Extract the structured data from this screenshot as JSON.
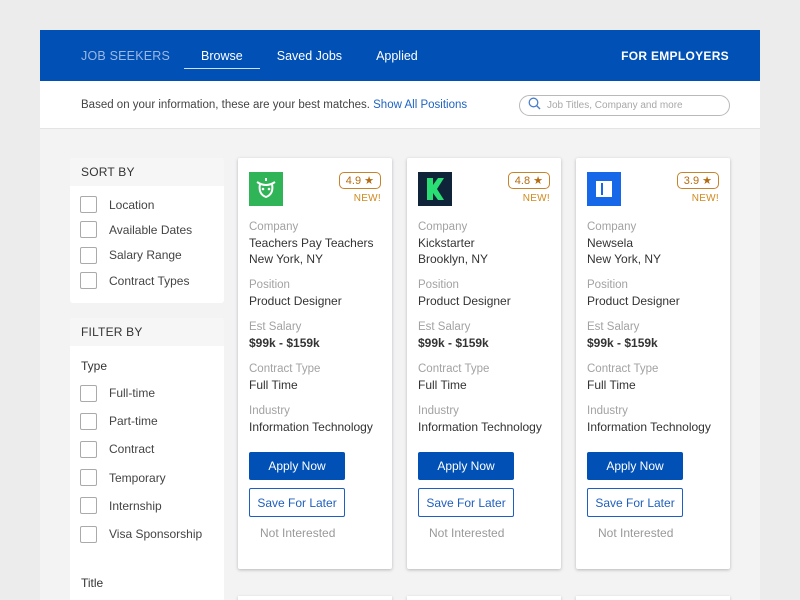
{
  "nav": {
    "brand": "JOB SEEKERS",
    "links": [
      "Browse",
      "Saved Jobs",
      "Applied"
    ],
    "active": "Browse",
    "employers": "FOR EMPLOYERS"
  },
  "info": {
    "message": "Based on your information, these are your best matches.",
    "link": "Show All Positions"
  },
  "search": {
    "placeholder": "Job Titles, Company and more"
  },
  "sort": {
    "heading": "SORT BY",
    "options": [
      "Location",
      "Available Dates",
      "Salary Range",
      "Contract Types"
    ]
  },
  "filter": {
    "heading": "FILTER BY",
    "type_label": "Type",
    "types": [
      "Full-time",
      "Part-time",
      "Contract",
      "Temporary",
      "Internship",
      "Visa Sponsorship"
    ],
    "title_label": "Title"
  },
  "labels": {
    "company": "Company",
    "position": "Position",
    "salary": "Est Salary",
    "contract": "Contract Type",
    "industry": "Industry",
    "apply": "Apply Now",
    "save": "Save For Later",
    "not_interested": "Not Interested",
    "new": "NEW!"
  },
  "jobs": [
    {
      "rating": "4.9 ★",
      "company": "Teachers Pay Teachers",
      "location": "New York, NY",
      "position": "Product Designer",
      "salary": "$99k - $159k",
      "contract": "Full Time",
      "industry": "Information Technology",
      "logo_icon": "tpt-apple-icon",
      "logo_color": "#2fb457"
    },
    {
      "rating": "4.8 ★",
      "company": "Kickstarter",
      "location": "Brooklyn, NY",
      "position": "Product Designer",
      "salary": "$99k - $159k",
      "contract": "Full Time",
      "industry": "Information Technology",
      "logo_icon": "kickstarter-k-icon",
      "logo_color": "#0f2438"
    },
    {
      "rating": "3.9 ★",
      "company": "Newsela",
      "location": "New York, NY",
      "position": "Product Designer",
      "salary": "$99k - $159k",
      "contract": "Full Time",
      "industry": "Information Technology",
      "logo_icon": "newsela-book-icon",
      "logo_color": "#1668e8"
    }
  ],
  "colors": {
    "primary": "#0050b5",
    "rating_accent": "#c6832a",
    "link": "#1f63c2"
  }
}
